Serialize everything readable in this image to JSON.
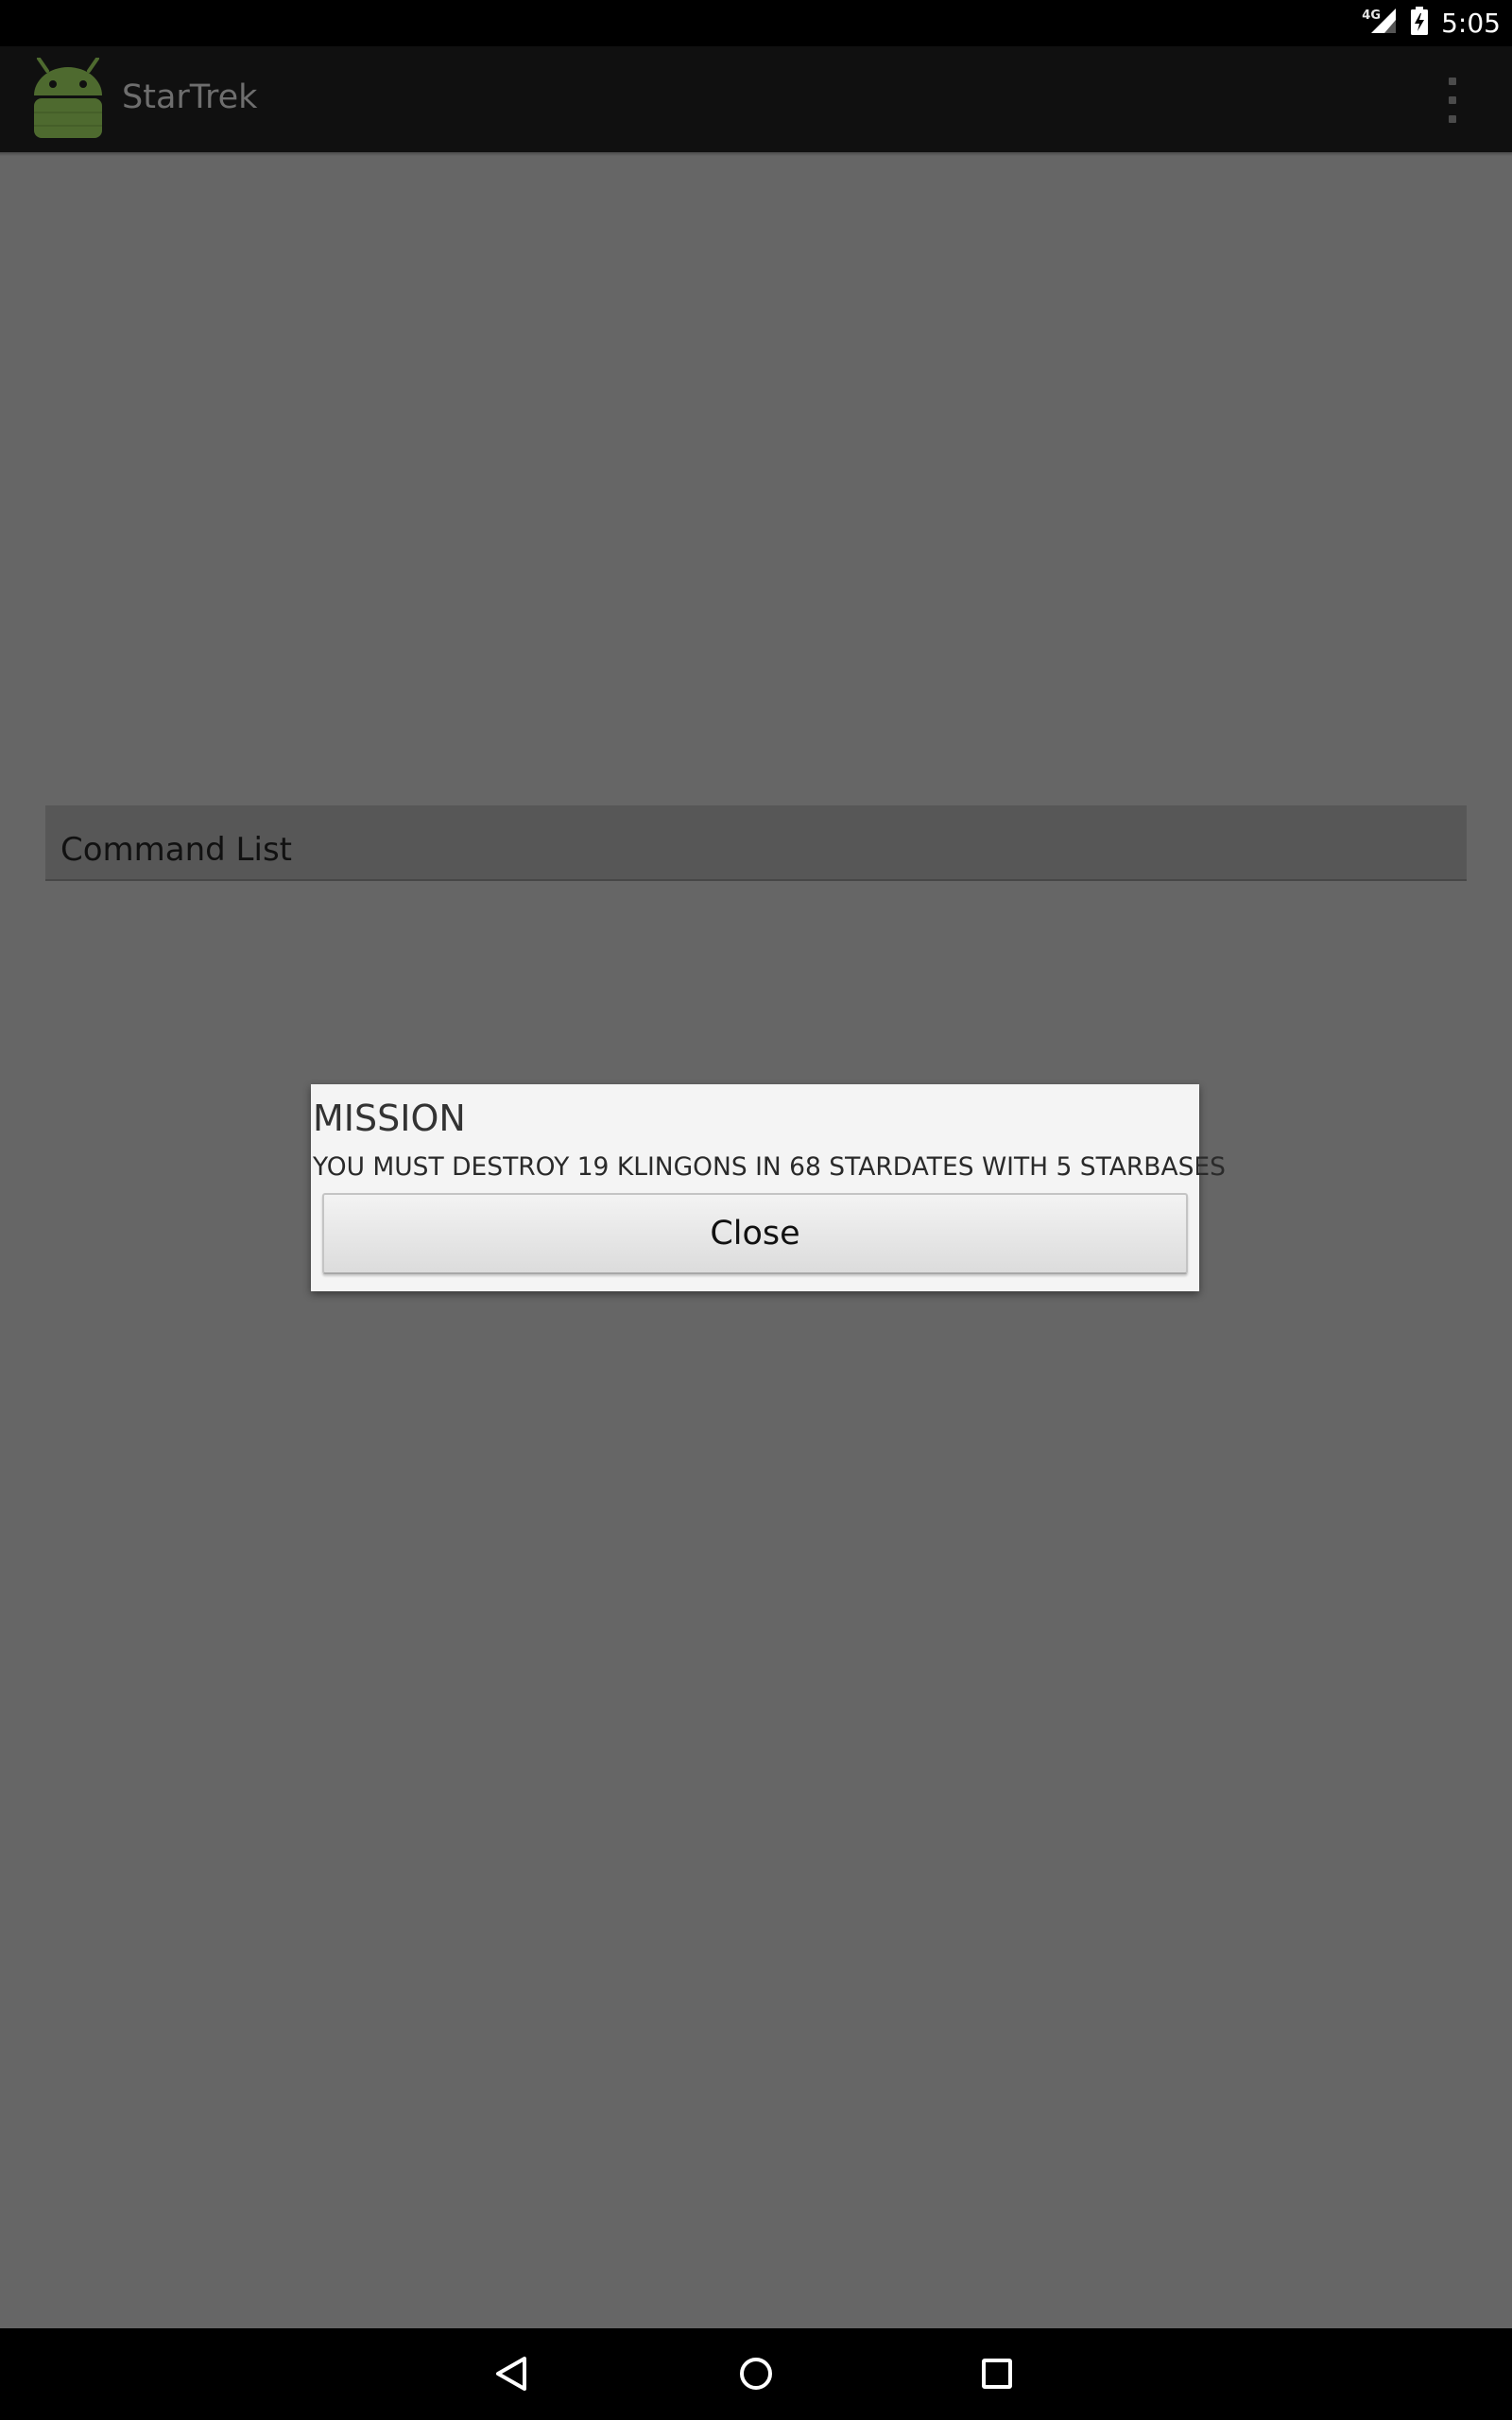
{
  "status_bar": {
    "network_type": "4G",
    "time": "5:05"
  },
  "action_bar": {
    "app_title": "StarTrek",
    "icons": {
      "app": "android-robot-icon",
      "overflow": "overflow-menu-icon"
    }
  },
  "main": {
    "command_list_label": "Command List"
  },
  "dialog": {
    "title": "MISSION",
    "message": "YOU MUST DESTROY 19 KLINGONS IN 68 STARDATES WITH 5 STARBASES",
    "close_label": "Close"
  },
  "nav_bar": {
    "icons": [
      "back-icon",
      "home-icon",
      "recents-icon"
    ]
  },
  "colors": {
    "background_dim": "#666666",
    "action_bar": "#101010",
    "dialog_background": "#f4f4f4",
    "android_green": "#4e6a2f"
  }
}
